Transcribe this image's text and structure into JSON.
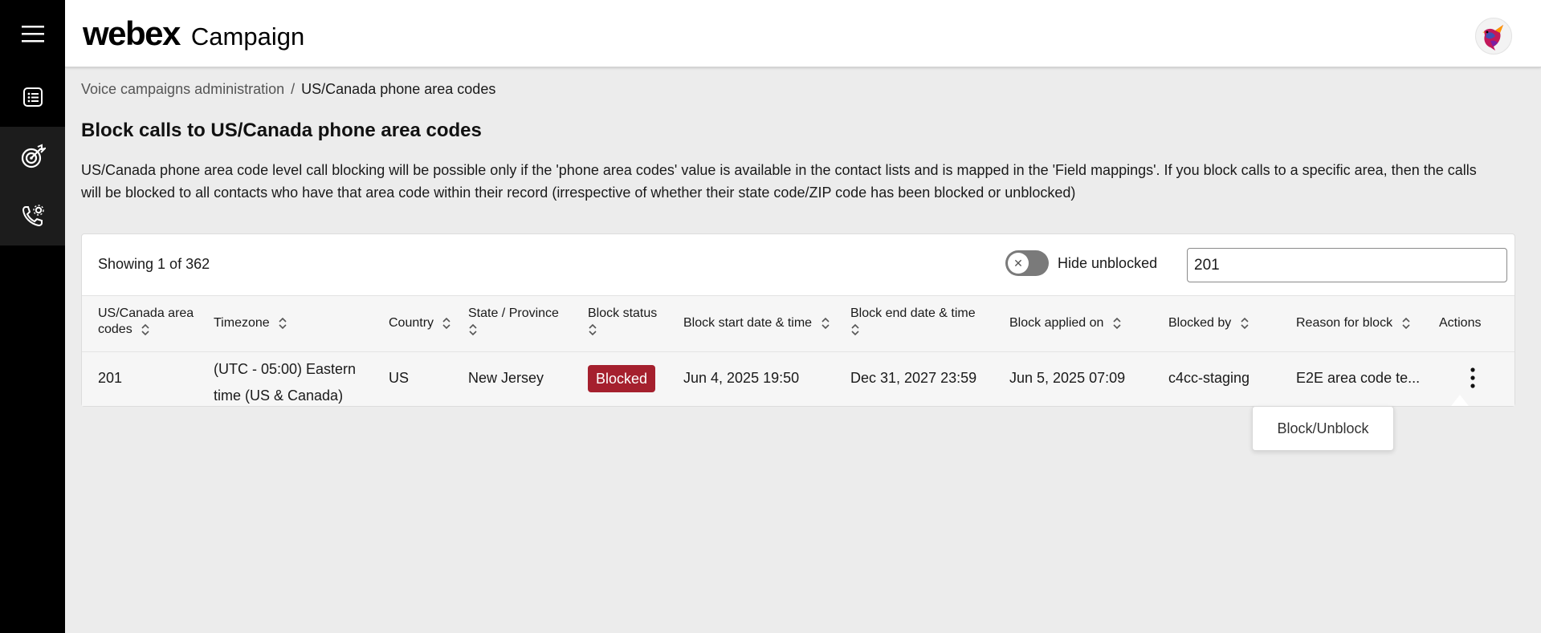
{
  "sidebar": {
    "items": [
      {
        "icon": "hamburger-menu-icon"
      },
      {
        "icon": "list-icon"
      },
      {
        "icon": "target-icon"
      },
      {
        "icon": "phone-settings-icon"
      }
    ]
  },
  "header": {
    "brand": "webex",
    "product": "Campaign"
  },
  "breadcrumb": {
    "parent": "Voice campaigns administration",
    "separator": "/",
    "current": "US/Canada phone area codes"
  },
  "page": {
    "title": "Block calls to US/Canada phone area codes",
    "description": "US/Canada phone area code level call blocking will be possible only if the 'phone area codes' value is available in the contact lists and is mapped in the 'Field mappings'. If you block calls to a specific area, then the calls will be blocked to all contacts who have that area code within their record (irrespective of whether their state code/ZIP code has been blocked or unblocked)"
  },
  "table_controls": {
    "showing": "Showing 1 of 362",
    "toggle_label": "Hide unblocked",
    "search_value": "201"
  },
  "table": {
    "columns": [
      {
        "line1": "US/Canada area",
        "line2": "codes"
      },
      {
        "line1": "Timezone",
        "line2": ""
      },
      {
        "line1": "Country",
        "line2": ""
      },
      {
        "line1": "State / Province",
        "line2": ""
      },
      {
        "line1": "Block status",
        "line2": ""
      },
      {
        "line1": "Block start date & time",
        "line2": ""
      },
      {
        "line1": "Block end date & time",
        "line2": ""
      },
      {
        "line1": "Block applied on",
        "line2": ""
      },
      {
        "line1": "Blocked by",
        "line2": ""
      },
      {
        "line1": "Reason for block",
        "line2": ""
      },
      {
        "line1": "Actions",
        "line2": ""
      }
    ],
    "rows": [
      {
        "area_code": "201",
        "timezone_line1": "(UTC - 05:00) Eastern",
        "timezone_line2": "time (US & Canada)",
        "country": "US",
        "state": "New Jersey",
        "status": "Blocked",
        "start": "Jun 4, 2025 19:50",
        "end": "Dec 31, 2027 23:59",
        "applied": "Jun 5, 2025 07:09",
        "blocked_by": "c4cc-staging",
        "reason": "E2E area code te..."
      }
    ]
  },
  "popover": {
    "label": "Block/Unblock"
  },
  "colors": {
    "blocked_badge": "#a5202e",
    "sidebar": "#000000",
    "background": "#ececec"
  }
}
